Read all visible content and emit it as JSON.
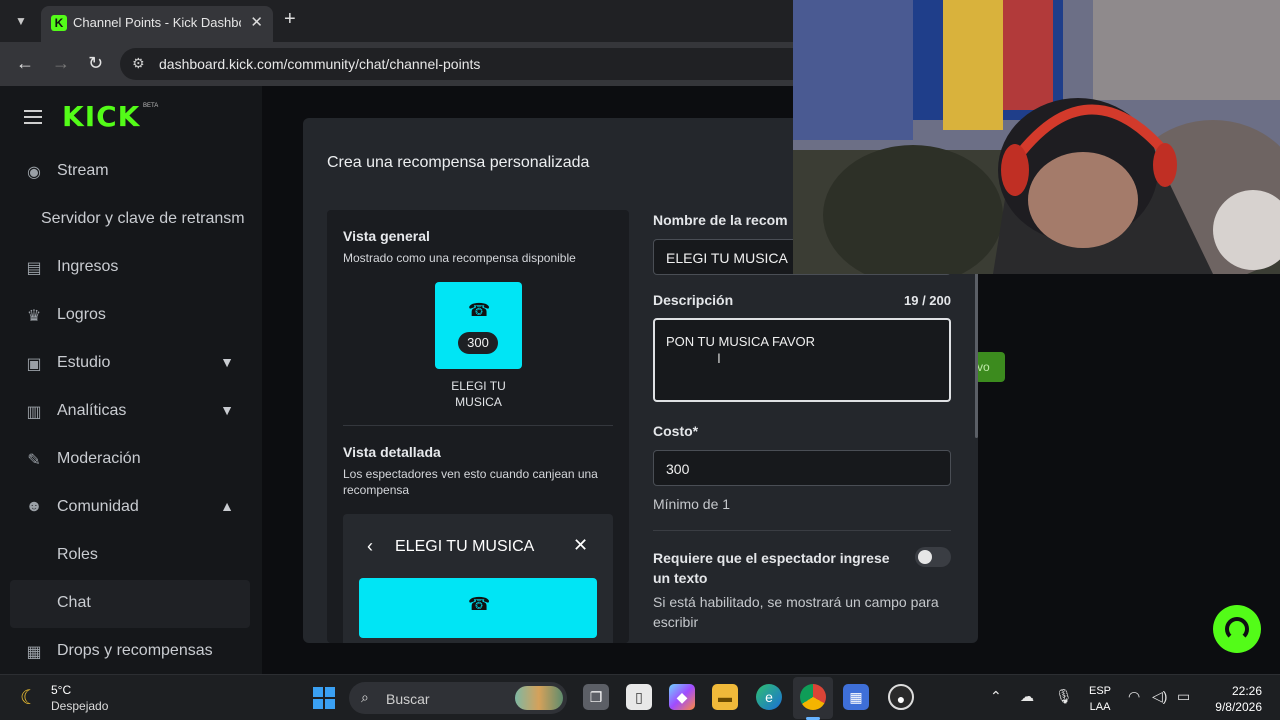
{
  "browser": {
    "tab_title": "Channel Points - Kick Dashboard",
    "tab_favicon_letter": "K",
    "url": "dashboard.kick.com/community/chat/channel-points"
  },
  "sidebar": {
    "logo": "KICK",
    "logo_badge": "BETA",
    "items": [
      {
        "label": "Stream",
        "icon": "broadcast-icon"
      },
      {
        "label": "Servidor y clave de retransm"
      },
      {
        "label": "Ingresos",
        "icon": "bar-chart-icon"
      },
      {
        "label": "Logros",
        "icon": "trophy-icon"
      },
      {
        "label": "Estudio",
        "icon": "studio-icon"
      },
      {
        "label": "Analíticas",
        "icon": "analytics-icon"
      },
      {
        "label": "Moderación",
        "icon": "wrench-icon"
      },
      {
        "label": "Comunidad",
        "icon": "community-icon"
      },
      {
        "label": "Roles"
      },
      {
        "label": "Chat"
      },
      {
        "label": "Drops y recompensas",
        "icon": "gift-icon"
      }
    ]
  },
  "background": {
    "partial_button": "vo"
  },
  "modal": {
    "title": "Crea una recompensa personalizada",
    "overview_heading": "Vista general",
    "overview_sub": "Mostrado como una recompensa disponible",
    "reward_cost": "300",
    "reward_name": "ELEGI TU MUSICA",
    "detail_heading": "Vista detallada",
    "detail_sub": "Los espectadores ven esto cuando canjean una recompensa",
    "detail_title": "ELEGI TU MUSICA",
    "name_label": "Nombre de la recom",
    "name_value": "ELEGI TU MUSICA",
    "desc_label": "Descripción",
    "desc_counter": "19 / 200",
    "desc_value": "PON TU MUSICA FAVOR",
    "cost_label": "Costo*",
    "cost_value": "300",
    "cost_hint": "Mínimo de 1",
    "toggle_title": "Requiere que el espectador ingrese un texto",
    "toggle_desc": "Si está habilitado, se mostrará un campo para escribir"
  },
  "taskbar": {
    "temperature": "5°C",
    "weather": "Despejado",
    "search_placeholder": "Buscar",
    "lang_1": "ESP",
    "lang_2": "LAA",
    "time": "22:26",
    "date": "9/8/2026"
  },
  "colors": {
    "kick_green": "#53fc18",
    "reward_cyan": "#00e5f5"
  }
}
